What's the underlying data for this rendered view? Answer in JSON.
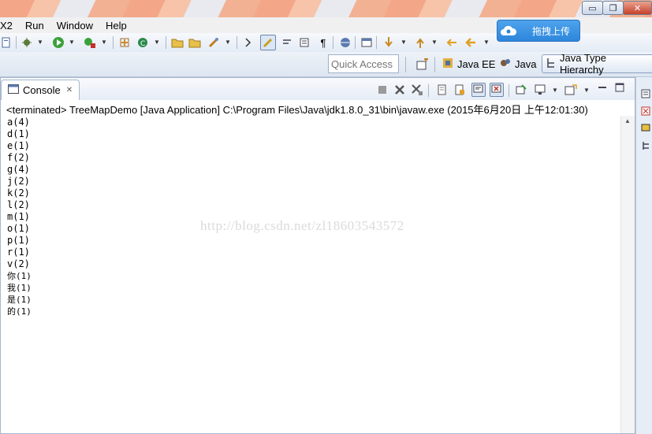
{
  "menu": [
    "X2",
    "Run",
    "Window",
    "Help"
  ],
  "window_buttons": {
    "minimize": "▭",
    "maximize": "❐",
    "close": "✕"
  },
  "upload": {
    "label": "拖拽上传"
  },
  "quick_access": {
    "placeholder": "Quick Access"
  },
  "perspectives": [
    {
      "label": "Java EE",
      "icon": "java-ee-perspective-icon"
    },
    {
      "label": "Java",
      "icon": "java-perspective-icon"
    },
    {
      "label": "Java Type Hierarchy",
      "icon": "type-hierarchy-perspective-icon"
    }
  ],
  "console": {
    "tab_label": "Console",
    "close_glyph": "✕",
    "status": "<terminated> TreeMapDemo [Java Application] C:\\Program Files\\Java\\jdk1.8.0_31\\bin\\javaw.exe (2015年6月20日 上午12:01:30)",
    "lines": [
      "a(4)",
      "d(1)",
      "e(1)",
      "f(2)",
      "g(4)",
      "j(2)",
      "k(2)",
      "l(2)",
      "m(1)",
      "o(1)",
      "p(1)",
      "r(1)",
      "v(2)",
      "你(1)",
      "我(1)",
      "是(1)",
      "的(1)"
    ]
  },
  "watermark": "http://blog.csdn.net/zl18603543572",
  "colors": {
    "accent": "#2d86db",
    "view_border": "#a7b7cf",
    "background": "#dfe8f4"
  }
}
